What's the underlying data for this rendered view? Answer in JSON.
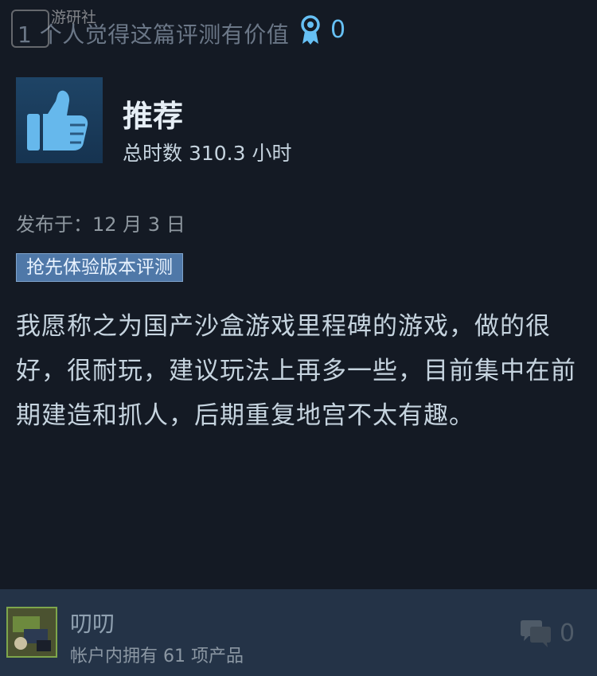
{
  "top": {
    "watermark_text": "游研社",
    "helpful_text": "1 个人觉得这篇评测有价值",
    "award_count": "0"
  },
  "review": {
    "verdict": "推荐",
    "hours": "总时数 310.3 小时",
    "posted": "发布于：12 月 3 日",
    "badge": "抢先体验版本评测",
    "body": "我愿称之为国产沙盒游戏里程碑的游戏，做的很好，很耐玩，建议玩法上再多一些，目前集中在前期建造和抓人，后期重复地宫不太有趣。"
  },
  "author": {
    "name": "叨叨",
    "products": "帐户内拥有 61 项产品",
    "comment_count": "0"
  },
  "colors": {
    "background": "#141a24",
    "accent": "#66c0f4",
    "badge_bg": "#4f78a8",
    "footer_bg": "#243347"
  },
  "icons": {
    "award": "award-ribbon-icon",
    "thumb": "thumbs-up-icon",
    "comment": "comment-bubbles-icon"
  }
}
